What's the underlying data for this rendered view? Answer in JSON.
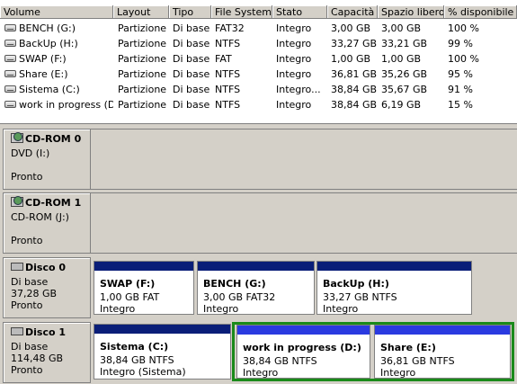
{
  "columns": [
    "Volume",
    "Layout",
    "Tipo",
    "File System",
    "Stato",
    "Capacità",
    "Spazio libero",
    "% disponibile"
  ],
  "volumes": [
    {
      "volume": "BENCH (G:)",
      "layout": "Partizione",
      "tipo": "Di base",
      "fs": "FAT32",
      "stato": "Integro",
      "cap": "3,00 GB",
      "free": "3,00 GB",
      "pct": "100 %"
    },
    {
      "volume": "BackUp (H:)",
      "layout": "Partizione",
      "tipo": "Di base",
      "fs": "NTFS",
      "stato": "Integro",
      "cap": "33,27 GB",
      "free": "33,21 GB",
      "pct": "99 %"
    },
    {
      "volume": "SWAP (F:)",
      "layout": "Partizione",
      "tipo": "Di base",
      "fs": "FAT",
      "stato": "Integro",
      "cap": "1,00 GB",
      "free": "1,00 GB",
      "pct": "100 %"
    },
    {
      "volume": "Share (E:)",
      "layout": "Partizione",
      "tipo": "Di base",
      "fs": "NTFS",
      "stato": "Integro",
      "cap": "36,81 GB",
      "free": "35,26 GB",
      "pct": "95 %"
    },
    {
      "volume": "Sistema (C:)",
      "layout": "Partizione",
      "tipo": "Di base",
      "fs": "NTFS",
      "stato": "Integro...",
      "cap": "38,84 GB",
      "free": "35,67 GB",
      "pct": "91 %"
    },
    {
      "volume": "work in progress (D:)",
      "layout": "Partizione",
      "tipo": "Di base",
      "fs": "NTFS",
      "stato": "Integro",
      "cap": "38,84 GB",
      "free": "6,19 GB",
      "pct": "15 %"
    }
  ],
  "disks": {
    "cd0": {
      "name": "CD-ROM 0",
      "l1": "DVD (I:)",
      "l2": "Pronto"
    },
    "cd1": {
      "name": "CD-ROM 1",
      "l1": "CD-ROM (J:)",
      "l2": "Pronto"
    },
    "d0": {
      "name": "Disco 0",
      "l1": "Di base",
      "l2": "37,28 GB",
      "l3": "Pronto",
      "parts": [
        {
          "n": "SWAP  (F:)",
          "s": "1,00 GB FAT",
          "st": "Integro"
        },
        {
          "n": "BENCH  (G:)",
          "s": "3,00 GB FAT32",
          "st": "Integro"
        },
        {
          "n": "BackUp  (H:)",
          "s": "33,27 GB NTFS",
          "st": "Integro"
        }
      ]
    },
    "d1": {
      "name": "Disco 1",
      "l1": "Di base",
      "l2": "114,48 GB",
      "l3": "Pronto",
      "parts": [
        {
          "n": "Sistema  (C:)",
          "s": "38,84 GB NTFS",
          "st": "Integro (Sistema)"
        },
        {
          "n": "work in progress  (D:)",
          "s": "38,84 GB NTFS",
          "st": "Integro"
        },
        {
          "n": "Share  (E:)",
          "s": "36,81 GB NTFS",
          "st": "Integro"
        }
      ]
    }
  }
}
